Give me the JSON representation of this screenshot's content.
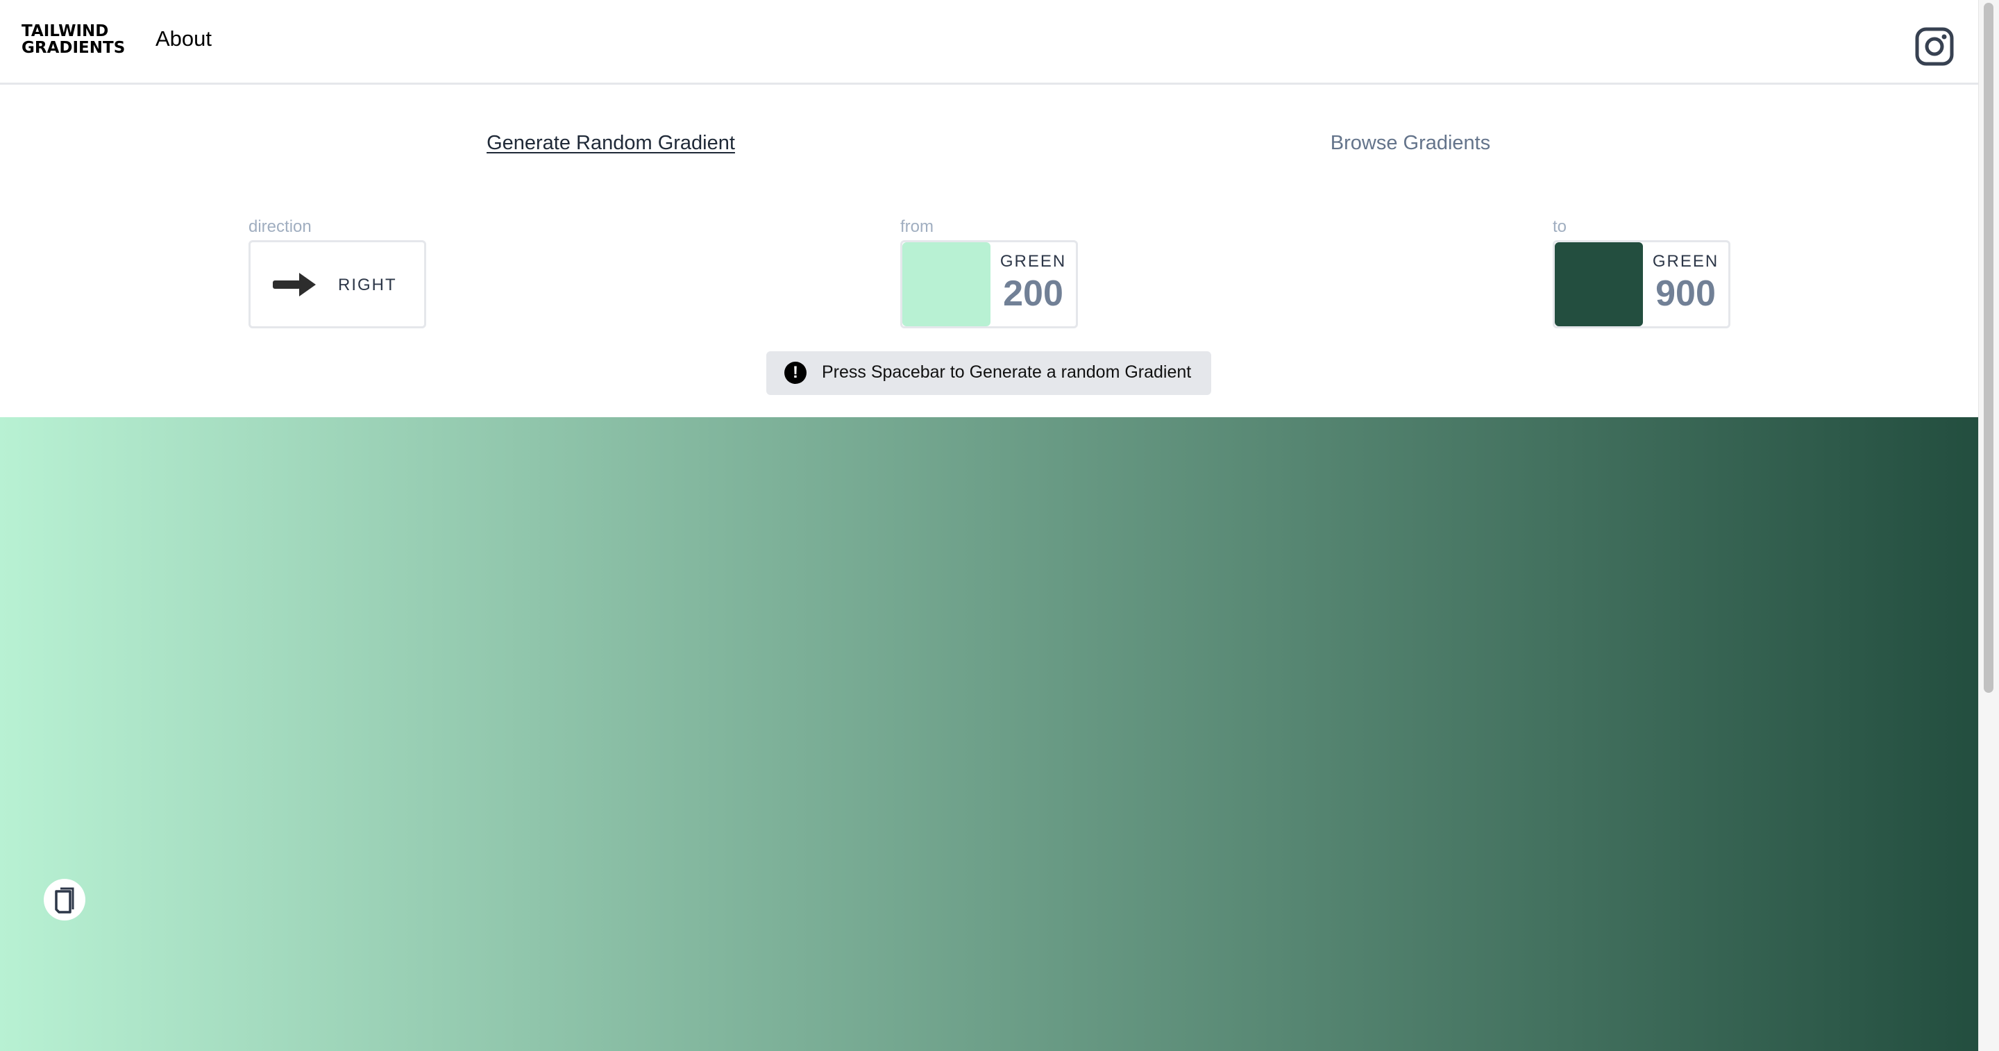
{
  "header": {
    "logo_line1": "TAILWIND",
    "logo_line2": "GRADIENTS",
    "about_label": "About",
    "social_icon": "instagram-icon"
  },
  "tabs": [
    {
      "label": "Generate Random Gradient",
      "active": true
    },
    {
      "label": "Browse Gradients",
      "active": false
    }
  ],
  "controls": {
    "direction": {
      "label": "direction",
      "value": "RIGHT",
      "icon": "arrow-right-icon"
    },
    "from": {
      "label": "from",
      "color_name": "GREEN",
      "shade": "200",
      "hex": "#b8f1d3"
    },
    "to": {
      "label": "to",
      "color_name": "GREEN",
      "shade": "900",
      "hex": "#234e3f"
    }
  },
  "hint": {
    "icon": "exclamation-icon",
    "icon_glyph": "!",
    "text": "Press Spacebar to Generate a random Gradient"
  },
  "gradient": {
    "direction": "to right",
    "copy_icon": "copy-icon"
  }
}
